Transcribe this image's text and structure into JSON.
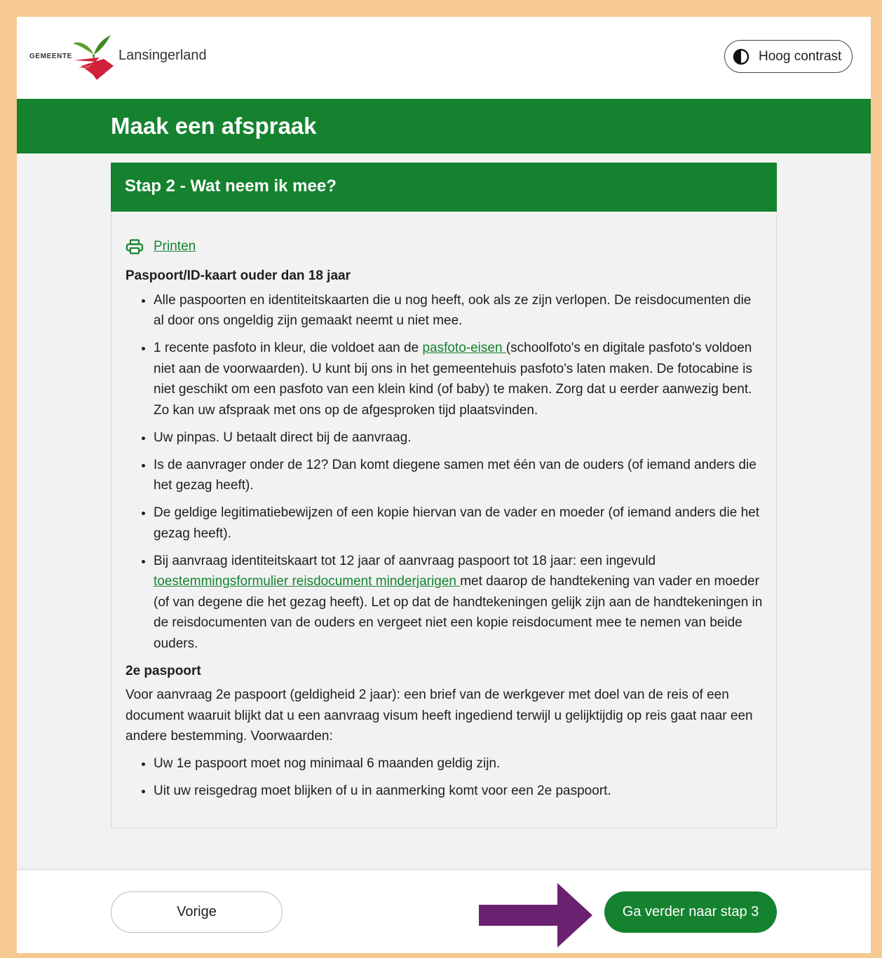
{
  "header": {
    "logo_prefix": "GEMEENTE",
    "logo_name": "Lansingerland",
    "contrast_label": "Hoog contrast"
  },
  "page_title": "Maak een afspraak",
  "step": {
    "title": "Stap 2 - Wat neem ik mee?",
    "print_label": "Printen",
    "section1": {
      "heading": "Paspoort/ID-kaart ouder dan 18 jaar",
      "item1": "Alle paspoorten en identiteitskaarten die u nog heeft, ook als ze zijn verlopen. De reisdocumenten die al door ons ongeldig zijn gemaakt neemt u niet mee.",
      "item2_before": "1 recente pasfoto in kleur, die voldoet aan de ",
      "item2_link": "pasfoto-eisen ",
      "item2_after": "(schoolfoto's en digitale pasfoto's voldoen niet aan de voorwaarden). U kunt bij ons in het gemeentehuis pasfoto's laten maken. De fotocabine is niet geschikt om een pasfoto van een klein kind (of baby) te maken. Zorg dat u eerder aanwezig bent. Zo kan uw afspraak met ons op de afgesproken tijd plaatsvinden.",
      "item3": "Uw pinpas. U betaalt direct bij de aanvraag.",
      "item4": "Is de aanvrager onder de 12? Dan komt diegene samen met één van de ouders (of iemand anders die het gezag heeft).",
      "item5": "De geldige legitimatiebewijzen of een kopie hiervan van de vader en moeder (of iemand anders die het gezag heeft).",
      "item6_before": "Bij aanvraag identiteitskaart tot 12 jaar of aanvraag paspoort tot 18 jaar: een ingevuld ",
      "item6_link": "toestemmingsformulier reisdocument minderjarigen ",
      "item6_after": "met daarop de handtekening van vader en moeder (of van degene die het gezag heeft). Let op dat de handtekeningen gelijk zijn aan de handtekeningen in de reisdocumenten van de ouders en vergeet niet een kopie reisdocument mee te nemen van beide ouders."
    },
    "section2": {
      "heading": "2e paspoort",
      "paragraph": "Voor aanvraag 2e paspoort (geldigheid 2 jaar): een brief van de werkgever met doel van de reis of een document waaruit blijkt dat u een aanvraag visum heeft ingediend terwijl u gelijktijdig op reis gaat naar een andere bestemming. Voorwaarden:",
      "item1": "Uw 1e paspoort moet nog minimaal 6 maanden geldig zijn.",
      "item2": "Uit uw reisgedrag moet blijken of u in aanmerking komt voor een 2e paspoort."
    }
  },
  "footer": {
    "prev_label": "Vorige",
    "next_label": "Ga verder naar stap 3"
  },
  "colors": {
    "brand_green": "#15822f",
    "outer_frame": "#f6c892",
    "annotation_arrow": "#6a2270"
  }
}
